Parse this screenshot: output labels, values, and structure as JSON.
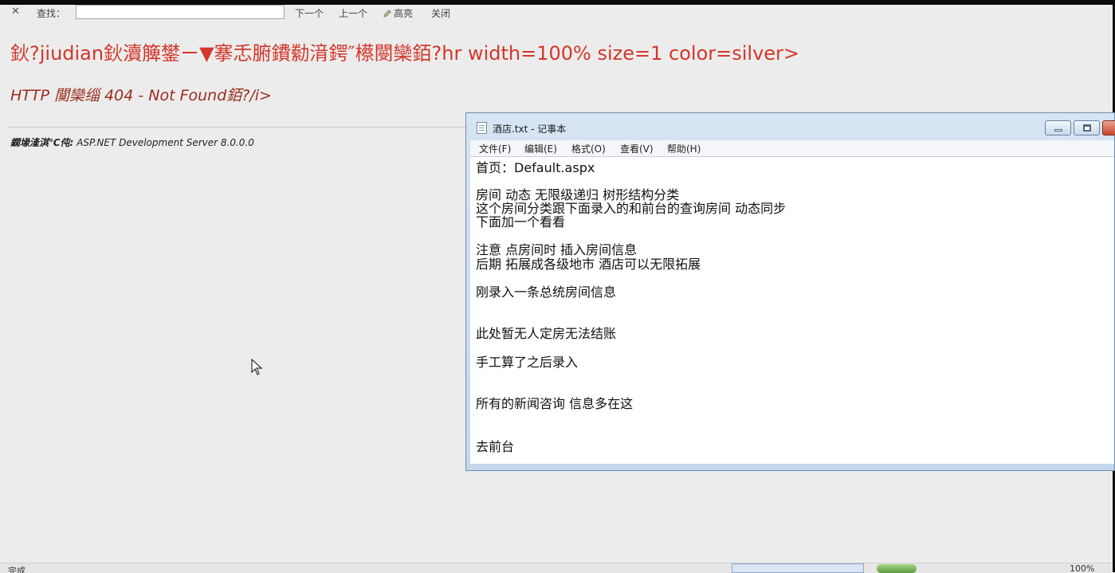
{
  "findbar": {
    "close_glyph": "✕",
    "label": "查找：",
    "input_value": "",
    "next": "下一个",
    "prev": "上一个",
    "highlight": "高亮",
    "close": "关闭"
  },
  "page": {
    "error_title": "鈥?jiudian鈥瀆簲鐢ㄧ▼搴忎腑鐨勬湇鍔″櫒閿欒銆?hr width=100% size=1 color=silver>",
    "error_subtitle": "HTTP 闃欒缁 404 - Not Found銆?/i>",
    "version_label": "鐗堟湰淇℃伅:",
    "version_value": "ASP.NET Development Server 8.0.0.0"
  },
  "notepad": {
    "title": "酒店.txt - 记事本",
    "menu": [
      "文件(F)",
      "编辑(E)",
      "格式(O)",
      "查看(V)",
      "帮助(H)"
    ],
    "lines": [
      "首页：Default.aspx",
      "房间 动态  无限级递归 树形结构分类",
      "这个房间分类跟下面录入的和前台的查询房间 动态同步",
      "下面加一个看看",
      "注意 点房间时 插入房间信息",
      "后期 拓展成各级地市 酒店可以无限拓展",
      "刚录入一条总统房间信息",
      "此处暂无人定房无法结账",
      "手工算了之后录入",
      "所有的新闻咨询 信息多在这",
      "去前台"
    ]
  },
  "statusbar": {
    "done": "完成",
    "zoom": "100%"
  }
}
